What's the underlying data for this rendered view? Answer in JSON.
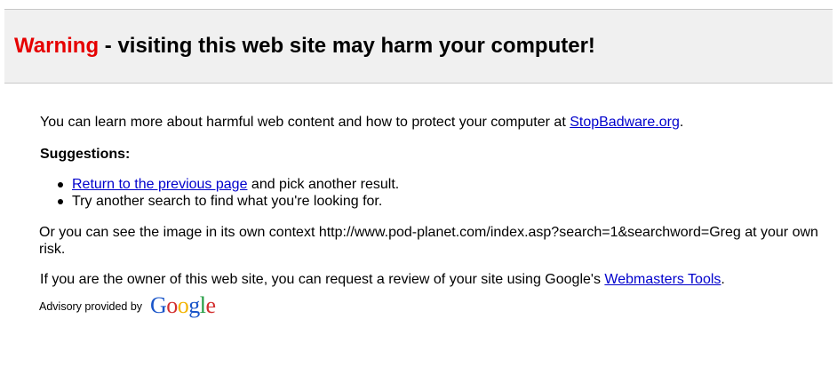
{
  "banner": {
    "warning_word": "Warning",
    "warning_rest": " - visiting this web site may harm your computer!"
  },
  "intro": {
    "text_before": "You can learn more about harmful web content and how to protect your computer at ",
    "link_label": "StopBadware.org",
    "text_after": "."
  },
  "suggestions": {
    "heading": "Suggestions:",
    "item1_link": "Return to the previous page",
    "item1_rest": " and pick another result.",
    "item2_text": "Try another search to find what you're looking for."
  },
  "context_text": "Or you can see the image in its own context http://www.pod-planet.com/index.asp?search=1&searchword=Greg at your own risk.",
  "owner": {
    "text_before": "If you are the owner of this web site, you can request a review of your site using Google's ",
    "link_label": "Webmasters Tools",
    "text_after": "."
  },
  "advisory": {
    "text": "Advisory provided by",
    "logo_letters": [
      "G",
      "o",
      "o",
      "g",
      "l",
      "e"
    ],
    "logo_colors": [
      "#1a55c9",
      "#d32f2f",
      "#f2b400",
      "#1a55c9",
      "#1e9a3e",
      "#d32f2f"
    ]
  },
  "colors": {
    "warning_red": "#e60000",
    "link_blue": "#0000cc",
    "banner_bg": "#f0f0f0"
  }
}
